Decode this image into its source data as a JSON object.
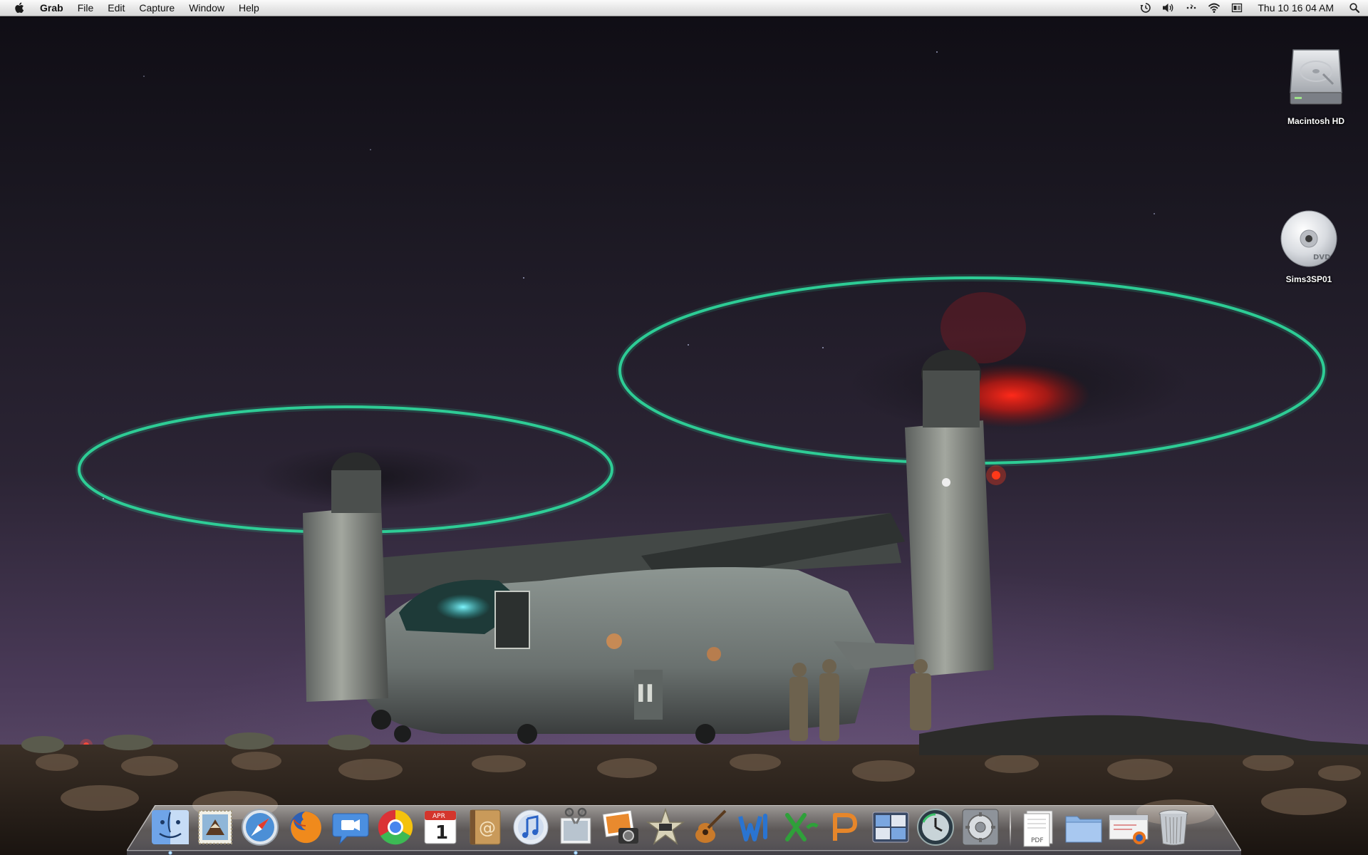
{
  "menubar": {
    "app_name": "Grab",
    "menus": [
      "File",
      "Edit",
      "Capture",
      "Window",
      "Help"
    ],
    "clock": "Thu 10 16 04 AM",
    "status_icons": [
      "time-machine-icon",
      "volume-icon",
      "bluetooth-icon",
      "wifi-icon",
      "input-menu-icon",
      "spotlight-icon"
    ]
  },
  "desktop": {
    "icons": [
      {
        "label": "Macintosh HD",
        "icon": "hard-drive-icon"
      },
      {
        "label": "Sims3SP01",
        "icon": "dvd-icon"
      }
    ],
    "dvd_disc_text": "DVD"
  },
  "dock": {
    "apps": [
      {
        "name": "Finder",
        "icon": "finder-icon",
        "running": true
      },
      {
        "name": "Mail",
        "icon": "mail-icon",
        "running": false
      },
      {
        "name": "Safari",
        "icon": "safari-icon",
        "running": false
      },
      {
        "name": "Firefox",
        "icon": "firefox-icon",
        "running": false
      },
      {
        "name": "iChat",
        "icon": "ichat-icon",
        "running": false
      },
      {
        "name": "Google Chrome",
        "icon": "chrome-icon",
        "running": false
      },
      {
        "name": "iCal",
        "icon": "calendar-icon",
        "running": false
      },
      {
        "name": "Address Book",
        "icon": "address-book-icon",
        "running": false
      },
      {
        "name": "iTunes",
        "icon": "itunes-icon",
        "running": false
      },
      {
        "name": "Grab",
        "icon": "grab-icon",
        "running": true
      },
      {
        "name": "iPhoto",
        "icon": "iphoto-icon",
        "running": false
      },
      {
        "name": "iMovie",
        "icon": "imovie-icon",
        "running": false
      },
      {
        "name": "GarageBand",
        "icon": "garageband-icon",
        "running": false
      },
      {
        "name": "Microsoft Word",
        "icon": "word-icon",
        "running": false
      },
      {
        "name": "Microsoft Excel",
        "icon": "excel-icon",
        "running": false
      },
      {
        "name": "Microsoft PowerPoint",
        "icon": "powerpoint-icon",
        "running": false
      },
      {
        "name": "Spaces",
        "icon": "spaces-icon",
        "running": false
      },
      {
        "name": "Time Machine",
        "icon": "time-machine-icon",
        "running": false
      },
      {
        "name": "System Preferences",
        "icon": "system-preferences-icon",
        "running": false
      }
    ],
    "stacks": [
      {
        "name": "Documents",
        "icon": "pdf-stack-icon"
      },
      {
        "name": "Applications",
        "icon": "folder-icon"
      },
      {
        "name": "Downloads",
        "icon": "downloads-stack-icon"
      },
      {
        "name": "Trash",
        "icon": "trash-icon"
      }
    ],
    "calendar": {
      "month": "APR",
      "day": "1"
    }
  },
  "colors": {
    "rotor_ring": "#2fd59a",
    "beacon": "#ff2a1a",
    "menubar": "#e8e8e8"
  }
}
